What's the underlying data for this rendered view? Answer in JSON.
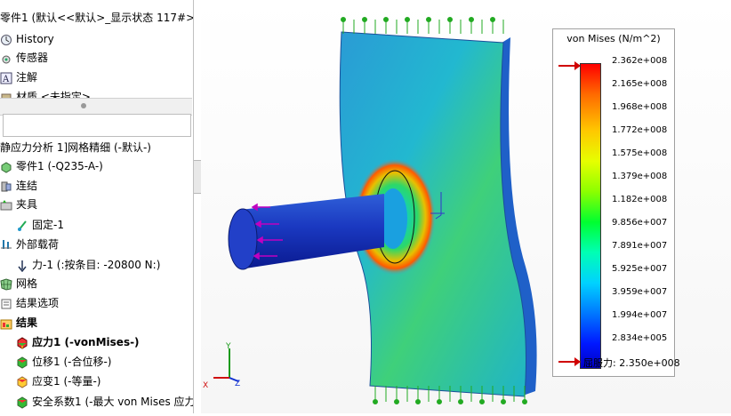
{
  "tree": {
    "part_title": "零件1  (默认<<默认>_显示状态 117#>)",
    "items_top": [
      {
        "label": "History",
        "icon": "history-icon"
      },
      {
        "label": "传感器",
        "icon": "sensor-icon"
      },
      {
        "label": "注解",
        "icon": "annotation-icon"
      },
      {
        "label": "材质 <未指定>",
        "icon": "material-icon"
      }
    ],
    "study_title": "静应力分析 1]网格精细 (-默认-)",
    "items_study": [
      {
        "label": "零件1 (-Q235-A-)",
        "icon": "part-icon",
        "indent": 0
      },
      {
        "label": "连结",
        "icon": "connection-icon",
        "indent": 0
      },
      {
        "label": "夹具",
        "icon": "fixture-icon",
        "indent": 0
      },
      {
        "label": "固定-1",
        "icon": "fixed-icon",
        "indent": 1
      },
      {
        "label": "外部载荷",
        "icon": "external-load-icon",
        "indent": 0
      },
      {
        "label": "力-1 (:按条目: -20800 N:)",
        "icon": "force-arrow-icon",
        "indent": 1
      },
      {
        "label": "网格",
        "icon": "mesh-icon",
        "indent": 0
      },
      {
        "label": "结果选项",
        "icon": "result-options-icon",
        "indent": 0
      },
      {
        "label": "结果",
        "icon": "results-folder-icon",
        "indent": 0,
        "bold": true
      },
      {
        "label": "应力1 (-vonMises-)",
        "icon": "stress-plot-icon",
        "indent": 1,
        "bold": true
      },
      {
        "label": "位移1 (-合位移-)",
        "icon": "displacement-plot-icon",
        "indent": 1
      },
      {
        "label": "应变1 (-等量-)",
        "icon": "strain-plot-icon",
        "indent": 1
      },
      {
        "label": "安全系数1 (-最大 von Mises 应力",
        "icon": "factor-of-safety-icon",
        "indent": 1
      }
    ]
  },
  "legend": {
    "title": "von Mises (N/m^2)",
    "ticks": [
      "2.362e+008",
      "2.165e+008",
      "1.968e+008",
      "1.772e+008",
      "1.575e+008",
      "1.379e+008",
      "1.182e+008",
      "9.856e+007",
      "7.891e+007",
      "5.925e+007",
      "3.959e+007",
      "1.994e+007",
      "2.834e+005"
    ],
    "yield_label": "屈服力: 2.350e+008",
    "max_color": "#ff0000",
    "min_color": "#0000c8"
  },
  "triad": {
    "x": "X",
    "y": "Y",
    "z": "Z"
  }
}
